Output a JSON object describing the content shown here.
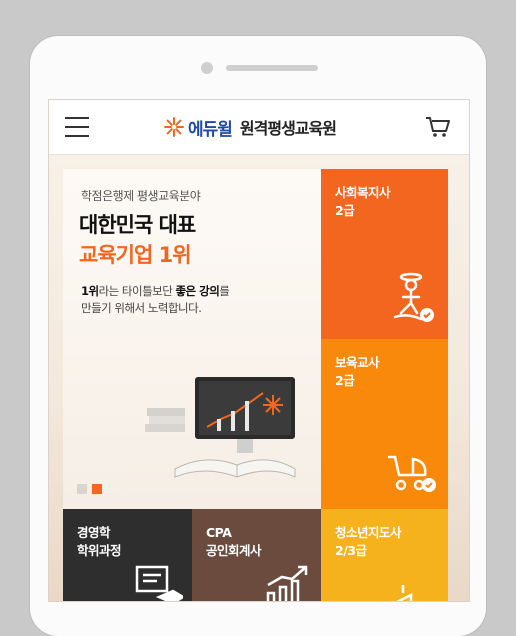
{
  "header": {
    "brand": "에듀윌",
    "service": "원격평생교육원",
    "menu_icon": "hamburger-menu-icon",
    "cart_icon": "cart-icon"
  },
  "hero": {
    "kicker": "학점은행제 평생교육분야",
    "title_line1": "대한민국 대표",
    "title_line2": "교육기업 1위",
    "desc_line1_bold": "1위",
    "desc_line1_rest": "라는 타이틀보단 ",
    "desc_line1_bold2": "좋은 강의",
    "desc_line1_end": "를",
    "desc_line2": "만들기 위해서 노력합니다.",
    "slides": 2,
    "active_slide": 2
  },
  "tiles": [
    {
      "label": "사회복지사\n2급",
      "icon": "social-worker-certificate-icon",
      "color": "#f2661f"
    },
    {
      "label": "보육교사\n2급",
      "icon": "stroller-certificate-icon",
      "color": "#f9890a"
    },
    {
      "label": "청소년지도사\n2/3급",
      "icon": "building-certificate-icon",
      "color": "#f5b21d"
    },
    {
      "label": "경영학\n학위과정",
      "icon": "lecture-board-icon",
      "color": "#2e2e2e"
    },
    {
      "label": "CPA\n공인회계사",
      "icon": "growth-chart-icon",
      "color": "#6a4b3d"
    }
  ],
  "colors": {
    "accent": "#f2661f",
    "brand_blue": "#1e4aa8",
    "dot_inactive": "#d9d4cf"
  }
}
